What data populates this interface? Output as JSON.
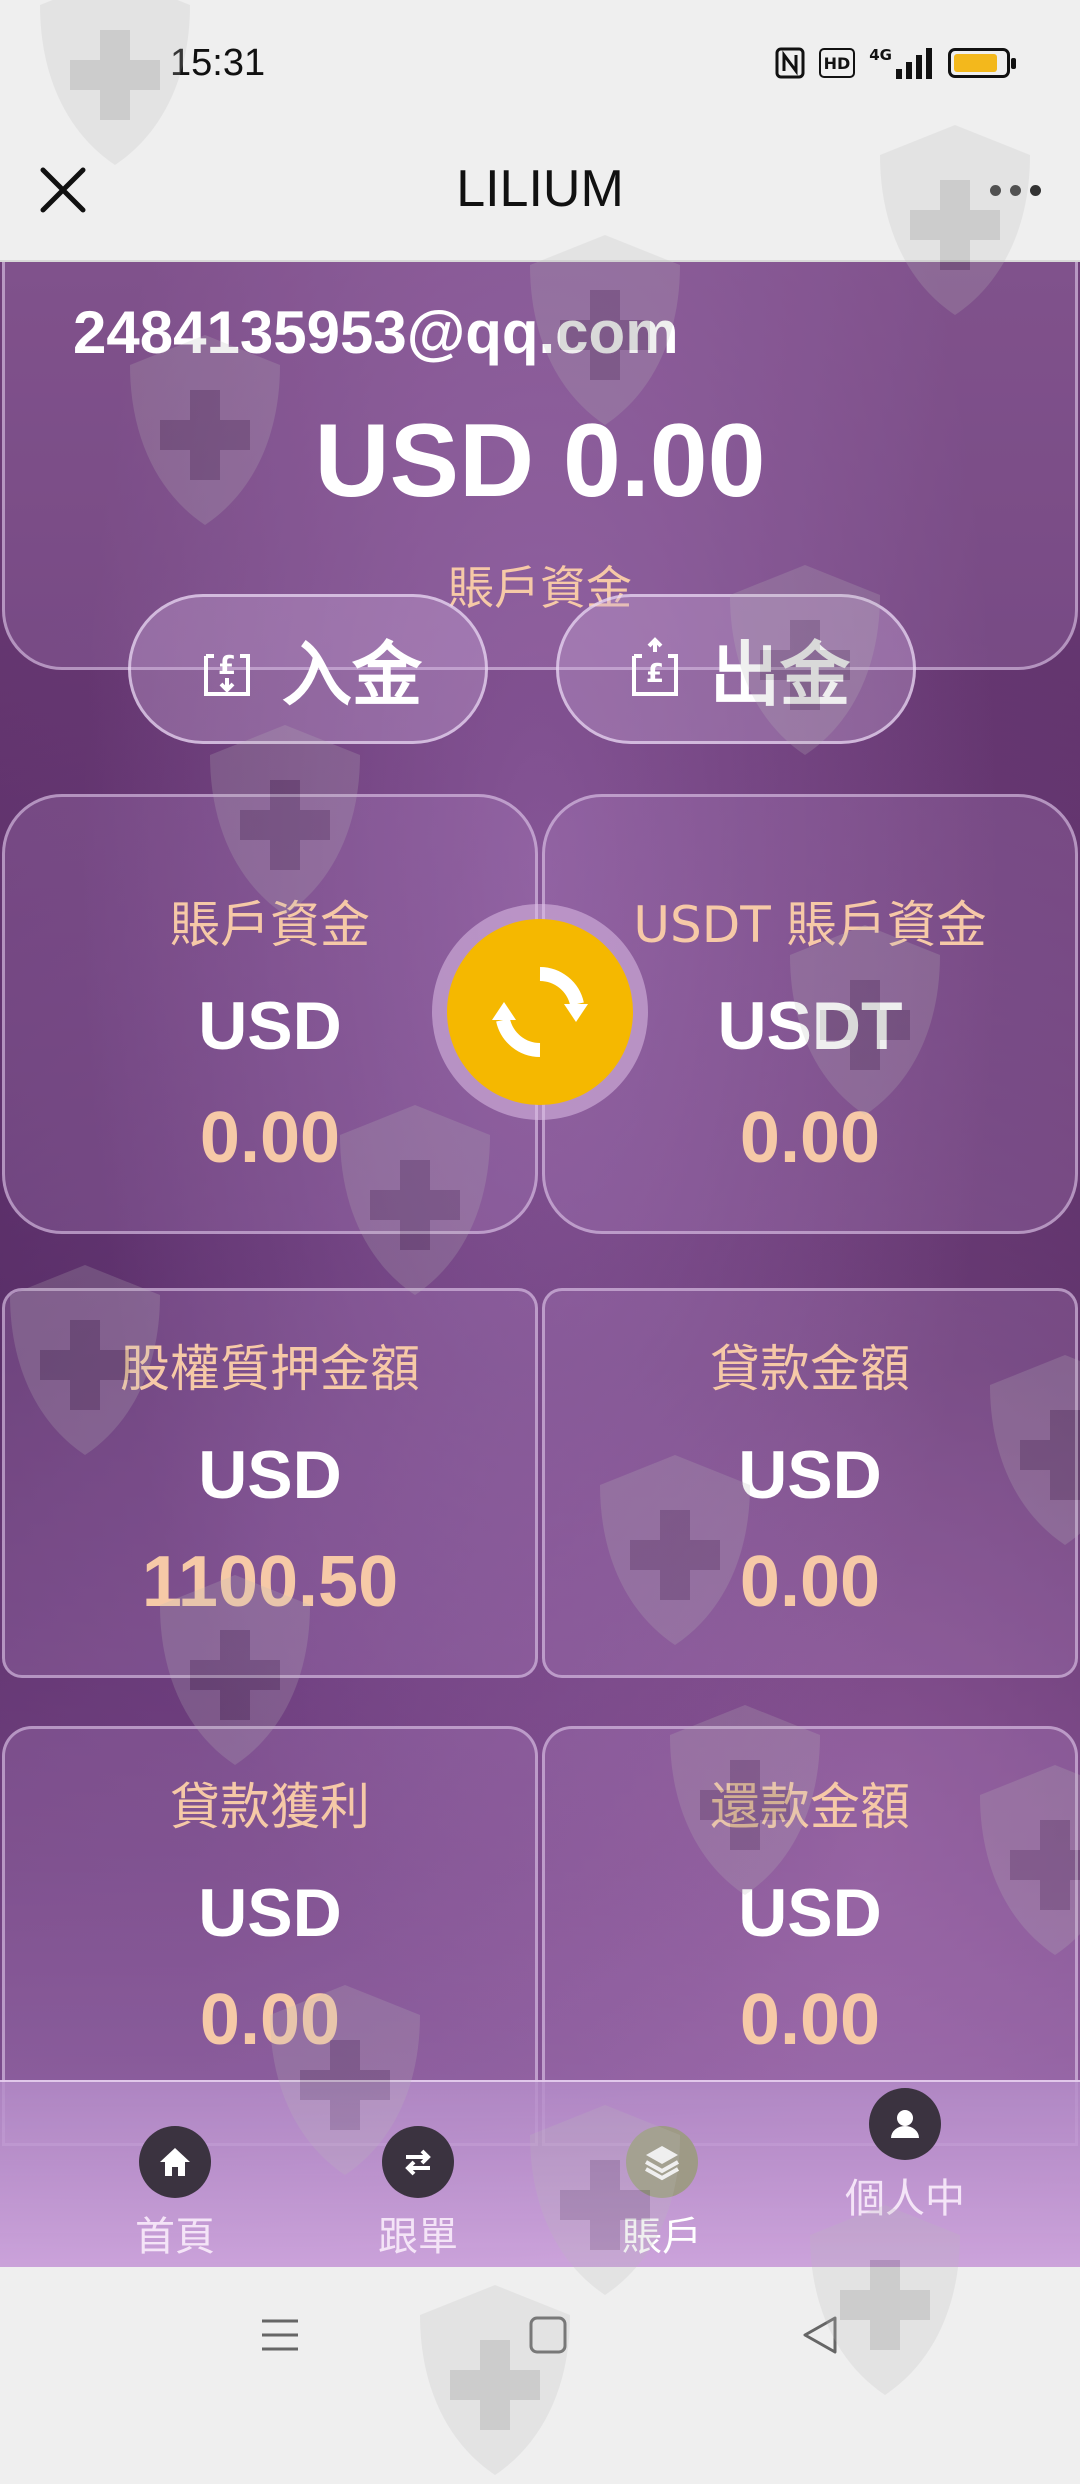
{
  "status_bar": {
    "time": "15:31",
    "hd_label": "HD",
    "network_label": "4G",
    "battery_level": 0.85
  },
  "app_bar": {
    "title": "LILIUM"
  },
  "account": {
    "email": "2484135953@qq.com",
    "total": "USD 0.00",
    "total_label": "賬戶資金"
  },
  "actions": {
    "deposit_label": "入金",
    "withdraw_label": "出金"
  },
  "cards": [
    {
      "title": "賬戶資金",
      "currency": "USD",
      "value": "0.00"
    },
    {
      "title": "USDT 賬戶資金",
      "currency": "USDT",
      "value": "0.00"
    },
    {
      "title": "股權質押金額",
      "currency": "USD",
      "value": "1100.50"
    },
    {
      "title": "貸款金額",
      "currency": "USD",
      "value": "0.00"
    },
    {
      "title": "貸款獲利",
      "currency": "USD",
      "value": "0.00"
    },
    {
      "title": "還款金額",
      "currency": "USD",
      "value": "0.00"
    }
  ],
  "bottom_nav": [
    {
      "label": "首頁",
      "icon": "home-icon"
    },
    {
      "label": "跟單",
      "icon": "swap-icon"
    },
    {
      "label": "賬戶",
      "icon": "layers-icon",
      "active": true
    },
    {
      "label": "個人中",
      "icon": "user-icon"
    }
  ],
  "colors": {
    "accent": "#f5b800",
    "label": "#f6c9a7",
    "background": "#5c2f68"
  }
}
